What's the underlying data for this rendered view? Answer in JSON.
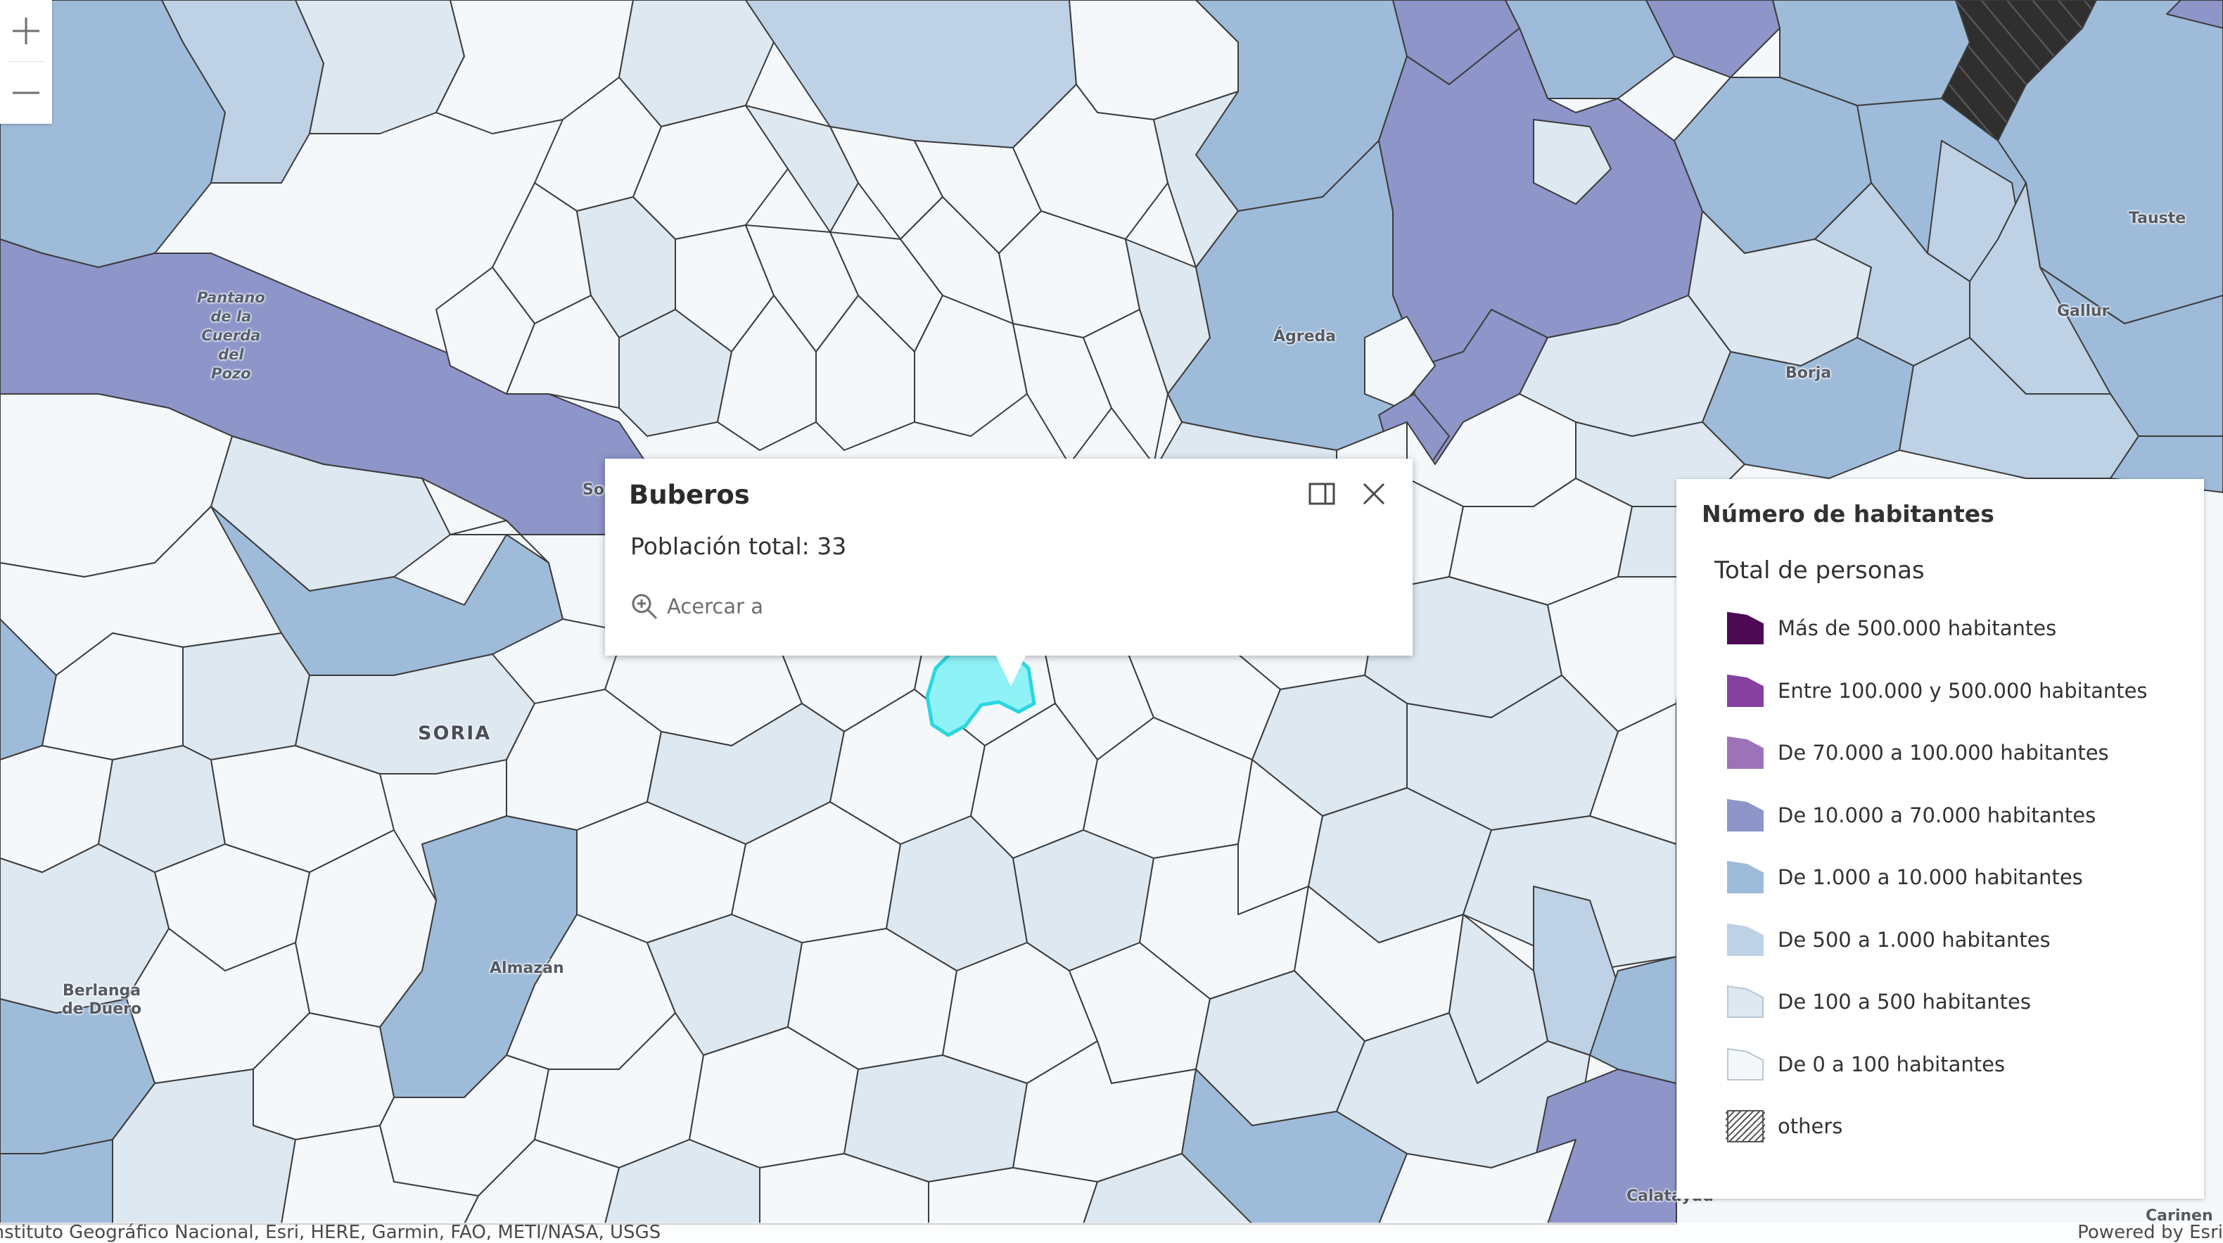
{
  "map": {
    "labels": {
      "pantano": "Pantano\nde la\nCuerda\ndel\nPozo",
      "soria": "SORIA",
      "so_partial": "So",
      "agreda": "Ágreda",
      "borja": "Borja",
      "tauste": "Tauste",
      "gallur": "Gallur",
      "almazan": "Almazán",
      "berlanga": "Berlanga\nde Duero",
      "calatayud": "Calatayud",
      "carinena_partial": "Carinen"
    },
    "colors": {
      "class_0_100": "#f4f8fb",
      "class_100_500": "#dde8f1",
      "class_500_1000": "#bed1e5",
      "class_1000_10000": "#9fbbda",
      "class_10000_70000": "#8d95c9",
      "selected": "#8ff2f6",
      "selected_outline": "#2bd6e0"
    }
  },
  "zoom": {
    "in_icon": "plus-icon",
    "out_icon": "minus-icon"
  },
  "popup": {
    "title": "Buberos",
    "body": "Población total: 33",
    "zoom_to": "Acercar a",
    "dock_icon": "dock-icon",
    "close_icon": "close-icon"
  },
  "legend": {
    "title": "Número de habitantes",
    "subtitle": "Total de personas",
    "items": [
      {
        "label": "Más de 500.000 habitantes",
        "color": "#4b0a53"
      },
      {
        "label": "Entre 100.000 y 500.000 habitantes",
        "color": "#8641a0"
      },
      {
        "label": "De 70.000 a 100.000 habitantes",
        "color": "#9c72b8"
      },
      {
        "label": "De 10.000 a 70.000 habitantes",
        "color": "#8d95c9"
      },
      {
        "label": "De 1.000 a 10.000 habitantes",
        "color": "#9fbbda"
      },
      {
        "label": "De 500 a 1.000 habitantes",
        "color": "#bed1e5"
      },
      {
        "label": "De 100 a 500 habitantes",
        "color": "#dde8f1"
      },
      {
        "label": "De 0 a 100 habitantes",
        "color": "#f4f8fb"
      },
      {
        "label": "others",
        "color": "hatch"
      }
    ]
  },
  "attribution": {
    "left": "Instituto Geográfico Nacional, Esri, HERE, Garmin, FAO, METI/NASA, USGS",
    "right": "Powered by Esri"
  }
}
